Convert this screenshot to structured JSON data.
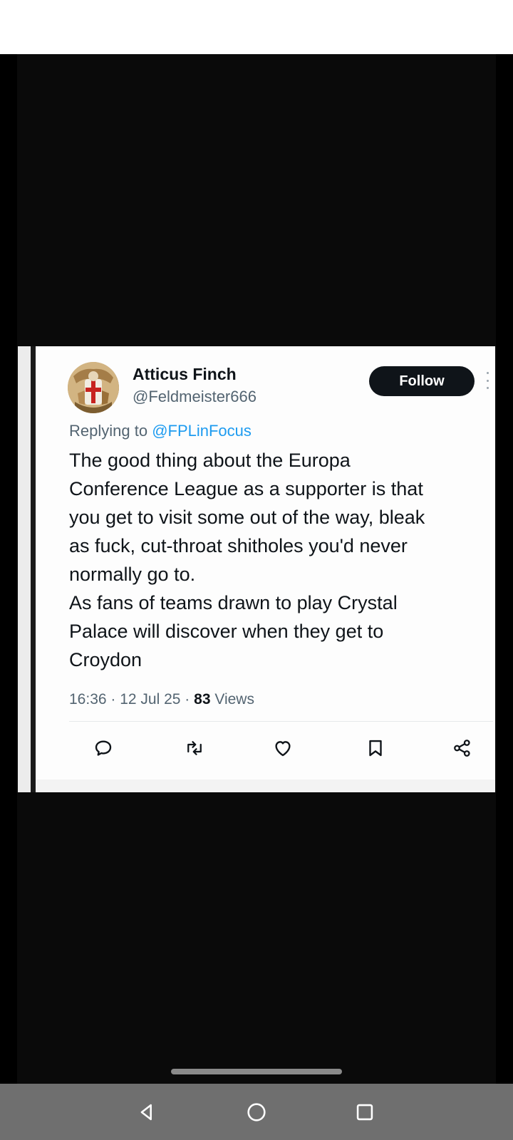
{
  "tweet": {
    "author_name": "Atticus Finch",
    "author_handle": "@Feldmeister666",
    "follow_label": "Follow",
    "reply_prefix": "Replying to ",
    "reply_mention": "@FPLinFocus",
    "text": "The good thing about the Europa\nConference League as a supporter is that\nyou get to visit some out of the way, bleak\nas fuck, cut-throat shitholes you'd never\nnormally go to.\nAs fans of teams drawn to play Crystal\nPalace will discover when they get to\nCroydon",
    "time": "16:36",
    "separator": " · ",
    "date": "12 Jul 25",
    "views_count": "83",
    "views_label": " Views",
    "actions": [
      {
        "name": "reply",
        "icon": "speech-bubble-icon"
      },
      {
        "name": "retweet",
        "icon": "retweet-icon"
      },
      {
        "name": "like",
        "icon": "heart-icon"
      },
      {
        "name": "bookmark",
        "icon": "bookmark-icon"
      },
      {
        "name": "share",
        "icon": "share-icon"
      }
    ]
  },
  "navbar": {
    "buttons": [
      "back",
      "home",
      "recents"
    ]
  },
  "colors": {
    "background": "#0a0a0a",
    "link": "#1d9bf0",
    "secondary_text": "#536471",
    "primary_text": "#0f1419",
    "navbar": "#6f6f6f"
  }
}
